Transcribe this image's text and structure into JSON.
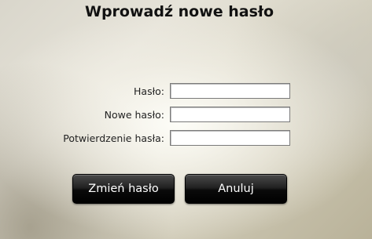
{
  "dialog": {
    "title": "Wprowadź nowe hasło"
  },
  "form": {
    "password_label": "Hasło:",
    "password_value": "",
    "new_password_label": "Nowe hasło:",
    "new_password_value": "",
    "confirm_label": "Potwierdzenie hasła:",
    "confirm_value": ""
  },
  "buttons": {
    "change_label": "Zmień hasło",
    "cancel_label": "Anuluj"
  }
}
